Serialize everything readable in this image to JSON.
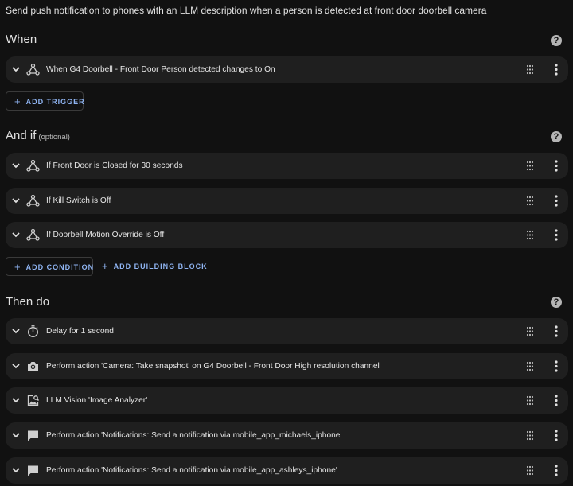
{
  "description": "Send push notification to phones with an LLM description when a person is detected at front door doorbell camera",
  "when": {
    "title": "When",
    "help": "?",
    "items": [
      {
        "label": "When G4 Doorbell - Front Door Person detected changes to On",
        "icon": "device-icon"
      }
    ],
    "add_trigger": "ADD TRIGGER"
  },
  "and_if": {
    "title": "And if",
    "optional": "(optional)",
    "help": "?",
    "items": [
      {
        "label": "If Front Door is Closed for 30 seconds",
        "icon": "device-icon"
      },
      {
        "label": "If Kill Switch is Off",
        "icon": "device-icon"
      },
      {
        "label": "If Doorbell Motion Override is Off",
        "icon": "device-icon"
      }
    ],
    "add_condition": "ADD CONDITION",
    "add_building_block": "ADD BUILDING BLOCK"
  },
  "then_do": {
    "title": "Then do",
    "help": "?",
    "items": [
      {
        "label": "Delay for 1 second",
        "icon": "timer-icon"
      },
      {
        "label": "Perform action 'Camera: Take snapshot' on G4 Doorbell - Front Door High resolution channel",
        "icon": "camera-icon"
      },
      {
        "label": "LLM Vision 'Image Analyzer'",
        "icon": "image-search-icon"
      },
      {
        "label": "Perform action 'Notifications: Send a notification via mobile_app_michaels_iphone'",
        "icon": "message-icon"
      },
      {
        "label": "Perform action 'Notifications: Send a notification via mobile_app_ashleys_iphone'",
        "icon": "message-icon"
      }
    ]
  }
}
